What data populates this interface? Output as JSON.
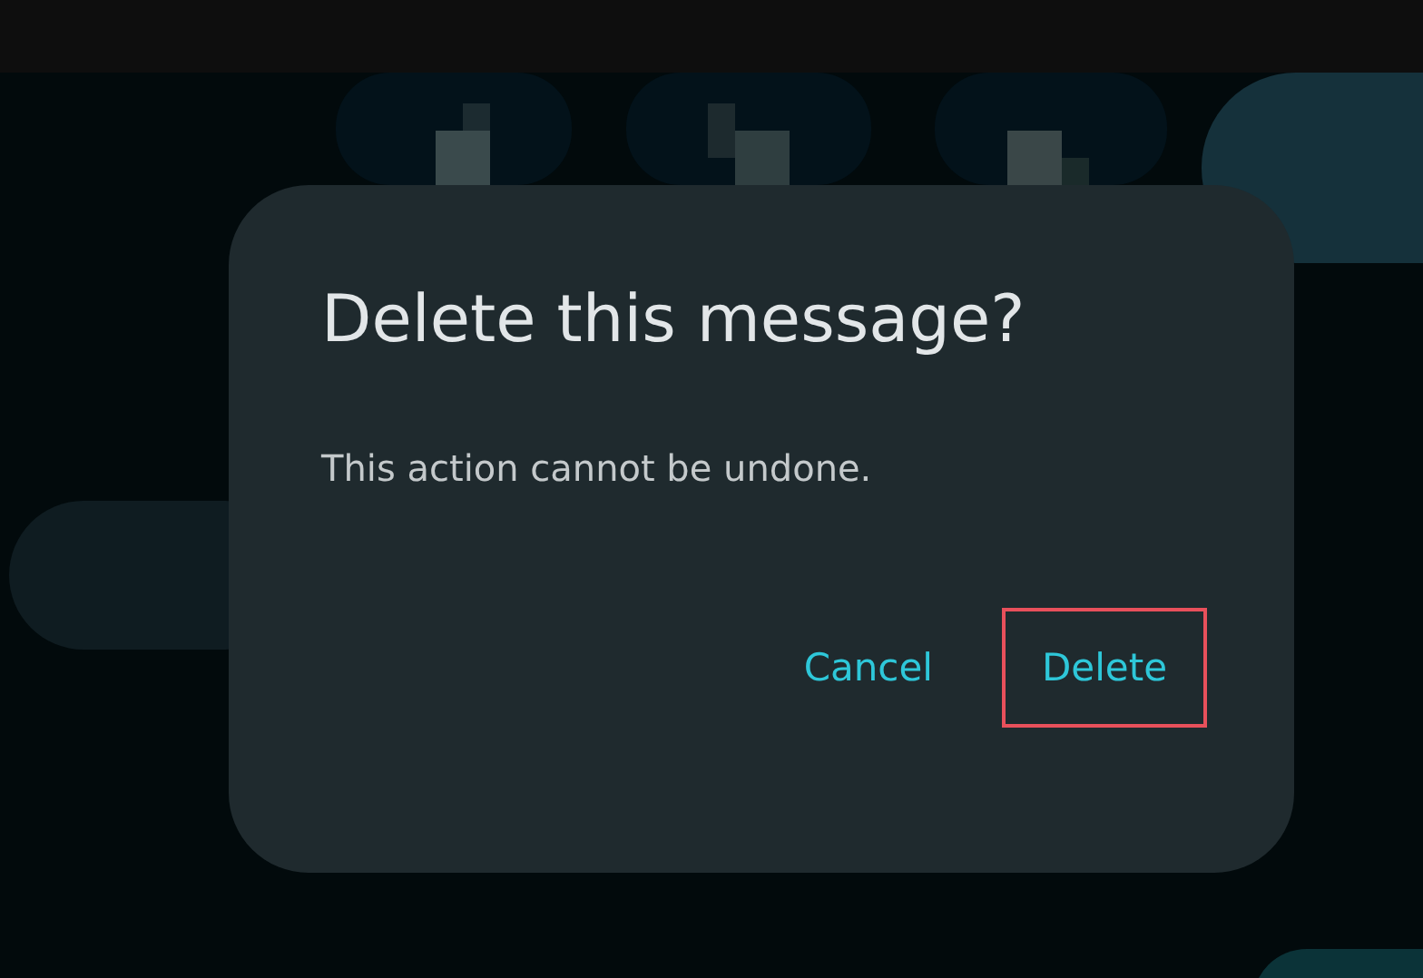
{
  "dialog": {
    "title": "Delete this message?",
    "message": "This action cannot be undone.",
    "buttons": [
      {
        "label": "Cancel",
        "highlighted": false
      },
      {
        "label": "Delete",
        "highlighted": true
      }
    ]
  }
}
